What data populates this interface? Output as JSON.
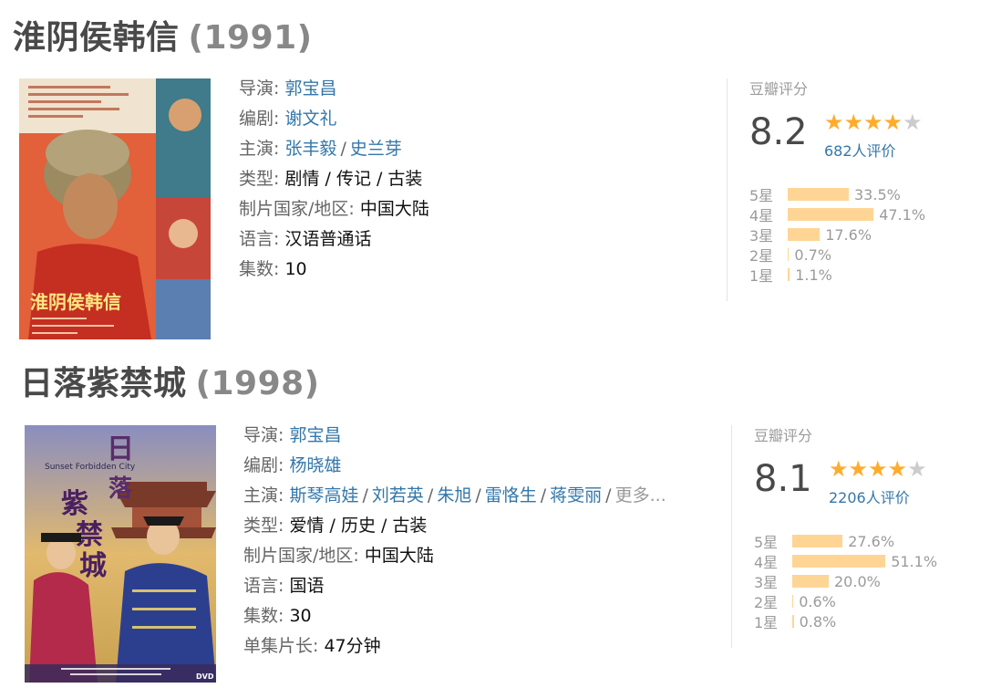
{
  "entries": [
    {
      "title": "淮阴侯韩信",
      "year": "(1991)",
      "poster": {
        "title_text": "淮阴侯韩信"
      },
      "info": {
        "director_label": "导演",
        "director": "郭宝昌",
        "writer_label": "编剧",
        "writer": "谢文礼",
        "cast_label": "主演",
        "cast": [
          "张丰毅",
          "史兰芽"
        ],
        "genre_label": "类型",
        "genre": "剧情 / 传记 / 古装",
        "country_label": "制片国家/地区",
        "country": "中国大陆",
        "language_label": "语言",
        "language": "汉语普通话",
        "episodes_label": "集数",
        "episodes": "10"
      },
      "rating": {
        "label": "豆瓣评分",
        "score": "8.2",
        "stars": 4,
        "votes": "682人评价",
        "breakdown": [
          {
            "label": "5星",
            "pct_text": "33.5%",
            "value": 33.5
          },
          {
            "label": "4星",
            "pct_text": "47.1%",
            "value": 47.1
          },
          {
            "label": "3星",
            "pct_text": "17.6%",
            "value": 17.6
          },
          {
            "label": "2星",
            "pct_text": "0.7%",
            "value": 0.7
          },
          {
            "label": "1星",
            "pct_text": "1.1%",
            "value": 1.1
          }
        ]
      }
    },
    {
      "title": "日落紫禁城",
      "year": "(1998)",
      "poster": {
        "title_text": "日落紫禁城",
        "en_text": "Sunset Forbidden City"
      },
      "info": {
        "director_label": "导演",
        "director": "郭宝昌",
        "writer_label": "编剧",
        "writer": "杨晓雄",
        "cast_label": "主演",
        "cast": [
          "斯琴高娃",
          "刘若英",
          "朱旭",
          "雷恪生",
          "蒋雯丽"
        ],
        "cast_more": "更多...",
        "genre_label": "类型",
        "genre": "爱情 / 历史 / 古装",
        "country_label": "制片国家/地区",
        "country": "中国大陆",
        "language_label": "语言",
        "language": "国语",
        "episodes_label": "集数",
        "episodes": "30",
        "runtime_label": "单集片长",
        "runtime": "47分钟"
      },
      "rating": {
        "label": "豆瓣评分",
        "score": "8.1",
        "stars": 4,
        "votes": "2206人评价",
        "breakdown": [
          {
            "label": "5星",
            "pct_text": "27.6%",
            "value": 27.6
          },
          {
            "label": "4星",
            "pct_text": "51.1%",
            "value": 51.1
          },
          {
            "label": "3星",
            "pct_text": "20.0%",
            "value": 20.0
          },
          {
            "label": "2星",
            "pct_text": "0.6%",
            "value": 0.6
          },
          {
            "label": "1星",
            "pct_text": "0.8%",
            "value": 0.8
          }
        ]
      }
    }
  ]
}
